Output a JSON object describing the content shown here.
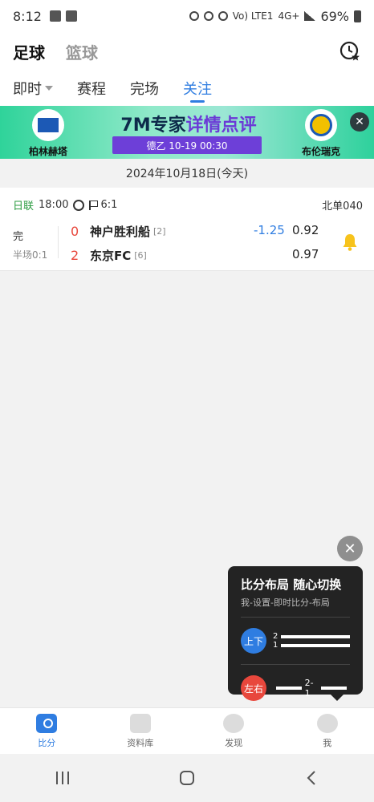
{
  "status_bar": {
    "time": "8:12",
    "network": "Vo) LTE1",
    "signal": "4G+",
    "battery": "69%"
  },
  "header": {
    "sport_active": "足球",
    "sport_inactive": "篮球"
  },
  "tabs": [
    {
      "label": "即时"
    },
    {
      "label": "赛程"
    },
    {
      "label": "完场"
    },
    {
      "label": "关注"
    }
  ],
  "banner": {
    "headline_prefix": "7M专家",
    "headline_highlight": "详情点评",
    "home_club": "柏林赫塔",
    "away_club": "布伦瑞克",
    "match_info": "德乙  10-19 00:30"
  },
  "date": "2024年10月18日(今天)",
  "match": {
    "league": "日联",
    "time": "18:00",
    "corners": "6:1",
    "code": "北单040",
    "status": "完",
    "halftime": "半场0:1",
    "home": {
      "score": "0",
      "name": "神户胜利船",
      "rank": "[2]"
    },
    "away": {
      "score": "2",
      "name": "东京FC",
      "rank": "[6]"
    },
    "handicap": "-1.25",
    "odds_home": "0.92",
    "odds_away": "0.97"
  },
  "popup": {
    "title": "比分布局 随心切换",
    "subtitle": "我-设置-即时比分-布局",
    "option1_label": "上下",
    "option1_line1": "2",
    "option1_line2": "1",
    "option2_label": "左右",
    "option2_score": "2-1"
  },
  "bottom_nav": [
    {
      "label": "比分"
    },
    {
      "label": "资料库"
    },
    {
      "label": "发现"
    },
    {
      "label": "我"
    }
  ],
  "colors": {
    "accent": "#2f7de1",
    "score_red": "#e8473c",
    "league_green": "#2a9b3f"
  }
}
